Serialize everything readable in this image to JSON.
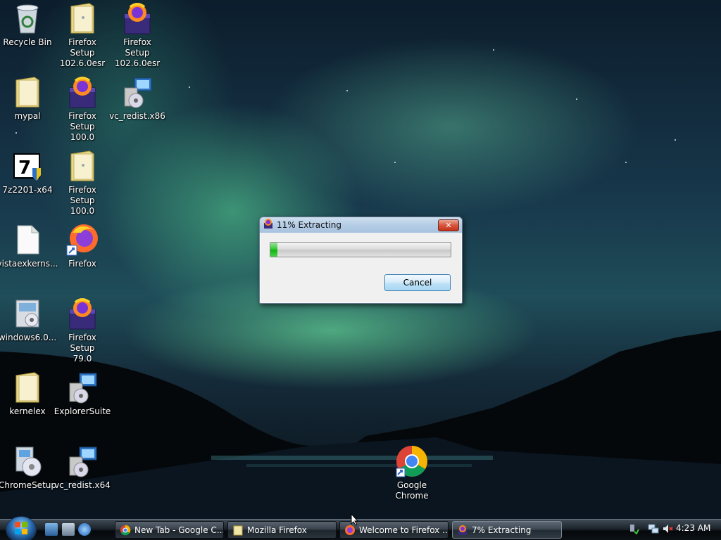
{
  "desktop": {
    "icons": [
      {
        "label": "Recycle Bin",
        "type": "recycle"
      },
      {
        "label": "Firefox Setup\n102.6.0esr",
        "type": "folder"
      },
      {
        "label": "Firefox Setup\n102.6.0esr",
        "type": "installer"
      },
      {
        "label": "mypal",
        "type": "folder"
      },
      {
        "label": "Firefox Setup\n100.0",
        "type": "installer"
      },
      {
        "label": "vc_redist.x86",
        "type": "setup"
      },
      {
        "label": "7z2201-x64",
        "type": "7zip"
      },
      {
        "label": "Firefox Setup\n100.0",
        "type": "folder"
      },
      {
        "label": "vistaexkerns...",
        "type": "file"
      },
      {
        "label": "Firefox",
        "type": "firefox"
      },
      {
        "label": "windows6.0...",
        "type": "update"
      },
      {
        "label": "Firefox Setup\n79.0",
        "type": "installer"
      },
      {
        "label": "kernelex",
        "type": "folder"
      },
      {
        "label": "ExplorerSuite",
        "type": "setup"
      },
      {
        "label": "ChromeSetup",
        "type": "cdsetup"
      },
      {
        "label": "vc_redist.x64",
        "type": "setup"
      },
      {
        "label": "Google\nChrome",
        "type": "chrome"
      }
    ]
  },
  "dialog": {
    "title": "11% Extracting",
    "progress": 0.04,
    "cancel_label": "Cancel",
    "close_symbol": "✕"
  },
  "taskbar": {
    "buttons": [
      {
        "label": "New Tab - Google C...",
        "icon": "chrome-icon"
      },
      {
        "label": "Mozilla Firefox",
        "icon": "folder-icon"
      },
      {
        "label": "Welcome to Firefox ...",
        "icon": "firefox-icon"
      },
      {
        "label": "7% Extracting",
        "icon": "installer-icon"
      }
    ],
    "clock": "4:23 AM"
  },
  "colors": {
    "progress_green": "#0fb80f",
    "dialog_bg": "#f0f0f0",
    "taskbar": "#1b2229"
  }
}
